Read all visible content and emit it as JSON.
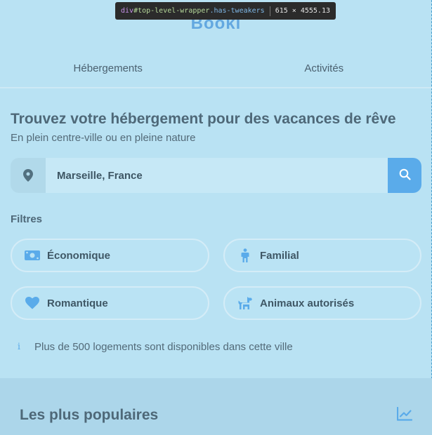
{
  "devtools": {
    "tag": "div",
    "id": "#top-level-wrapper",
    "class": ".has-tweakers",
    "size": "615 × 4555.13"
  },
  "header": {
    "logo": "Booki",
    "tabs": [
      {
        "label": "Hébergements"
      },
      {
        "label": "Activités"
      }
    ]
  },
  "main": {
    "title": "Trouvez votre hébergement pour des vacances de rêve",
    "subtitle": "En plein centre-ville ou en pleine nature",
    "search": {
      "value": "Marseille, France",
      "pin_icon": "map-pin-icon",
      "button_icon": "search-icon"
    },
    "filters_label": "Filtres",
    "filters": [
      {
        "label": "Économique",
        "icon": "money-icon"
      },
      {
        "label": "Familial",
        "icon": "person-icon"
      },
      {
        "label": "Romantique",
        "icon": "heart-icon"
      },
      {
        "label": "Animaux autorisés",
        "icon": "dog-icon"
      }
    ],
    "info": {
      "icon": "info-icon",
      "glyph": "i",
      "text": "Plus de 500 logements sont disponibles dans cette ville"
    }
  },
  "popular": {
    "title": "Les plus populaires",
    "icon": "trend-chart-icon"
  },
  "colors": {
    "accent": "#5aabea",
    "background": "#b9e2f3",
    "text": "#4e6878"
  }
}
